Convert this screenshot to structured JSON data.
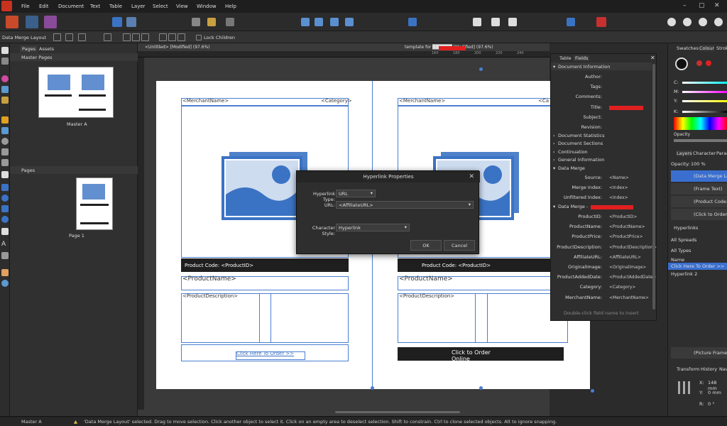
{
  "menu": [
    "File",
    "Edit",
    "Document",
    "Text",
    "Table",
    "Layer",
    "Select",
    "View",
    "Window",
    "Help"
  ],
  "context": {
    "selection": "Data Merge Layout",
    "lock_children": "Lock Children"
  },
  "tabs": {
    "untitled": "<Untitled> [Modified] (97.6%)",
    "template": "template for ██████ [Modified] (97.6%)"
  },
  "ruler": {
    "n1": "160",
    "n2": "180",
    "n3": "200",
    "n4": "220",
    "n5": "240"
  },
  "pages_panel": {
    "tab_pages": "Pages",
    "tab_assets": "Assets",
    "master_pages": "Master Pages",
    "master_a": "Master A",
    "pages": "Pages",
    "page1": "Page 1"
  },
  "spread": {
    "merchant": "<MerchantName>",
    "category": "<Category>",
    "product_code": "Product Code: <ProductID>",
    "product_name": "<ProductName>",
    "product_desc": "<ProductDescription>",
    "click_here": "Click Here To Order >>",
    "click_online": "Click to Order Online",
    "category_cut": "<Ca"
  },
  "dialog": {
    "title": "Hyperlink Properties",
    "type_label": "Hyperlink Type:",
    "type_value": "URL",
    "url_label": "URL:",
    "url_value": "<AffiliateURL>",
    "style_label": "Character Style:",
    "style_value": "Hyperlink",
    "ok": "OK",
    "cancel": "Cancel"
  },
  "fields_panel": {
    "tab_table": "Table",
    "tab_fields": "Fields",
    "doc_info": "Document Information",
    "author": "Author:",
    "tags": "Tags:",
    "comments": "Comments:",
    "title": "Title:",
    "subject": "Subject:",
    "revision": "Revision:",
    "doc_stats": "Document Statistics",
    "doc_sections": "Document Sections",
    "continuation": "Continuation",
    "general_info": "General Information",
    "data_merge": "Data Merge",
    "source": "Source:",
    "source_v": "<Name>",
    "merge_index": "Merge Index:",
    "merge_index_v": "<Index>",
    "unfiltered": "Unfiltered Index:",
    "unfiltered_v": "<Index>",
    "data_merge_sub": "Data Merge - ",
    "rows": [
      {
        "k": "ProductID:",
        "v": "<ProductID>"
      },
      {
        "k": "ProductName:",
        "v": "<ProductName>"
      },
      {
        "k": "ProductPrice:",
        "v": "<ProductPrice>"
      },
      {
        "k": "ProductDescription:",
        "v": "<ProductDescription>"
      },
      {
        "k": "AffiliateURL:",
        "v": "<AffiliateURL>"
      },
      {
        "k": "OriginalImage:",
        "v": "<OriginalImage>"
      },
      {
        "k": "ProductAddedDate:",
        "v": "<ProductAddedDate>"
      },
      {
        "k": "Category:",
        "v": "<Category>"
      },
      {
        "k": "MerchantName:",
        "v": "<MerchantName>"
      }
    ],
    "hint": "Double-click field name to insert"
  },
  "right_panel": {
    "swatches": "Swatches",
    "colour": "Colour",
    "stroke": "Stroke",
    "c": "C:",
    "m": "M:",
    "y": "Y:",
    "k": "K:",
    "opacity": "Opacity",
    "layers": "Layers",
    "character": "Character",
    "paragraph": "Parag",
    "opacity_lbl": "Opacity:",
    "opacity_val": "100 %",
    "layer1": "(Data Merge Layo",
    "layer2": "(Frame Text)",
    "layer3": "(Product Code:",
    "layer4": "(Click to Order O",
    "hyperlinks": "Hyperlinks",
    "all_spreads": "All Spreads",
    "all_types": "All Types",
    "name_col": "Name",
    "link1": "Click Here To Order >>",
    "link2": "Hyperlink 2",
    "picture_frame": "(Picture Frame)",
    "transform": "Transform",
    "history": "History",
    "nav": "Navi",
    "x": "X:",
    "x_val": "148 mm",
    "y_val": "0 mm",
    "r": "R:",
    "r_val": "0 °"
  },
  "status": {
    "master": "Master A",
    "message": "'Data Merge Layout' selected. Drag to move selection. Click another object to select it. Click on an empty area to deselect selection. Shift to constrain. Ctrl to clone selected objects. Alt to ignore snapping."
  },
  "colors": {
    "accent": "#3b73c4",
    "brand": "#c8321e",
    "highlight": "#3a6fd0"
  }
}
